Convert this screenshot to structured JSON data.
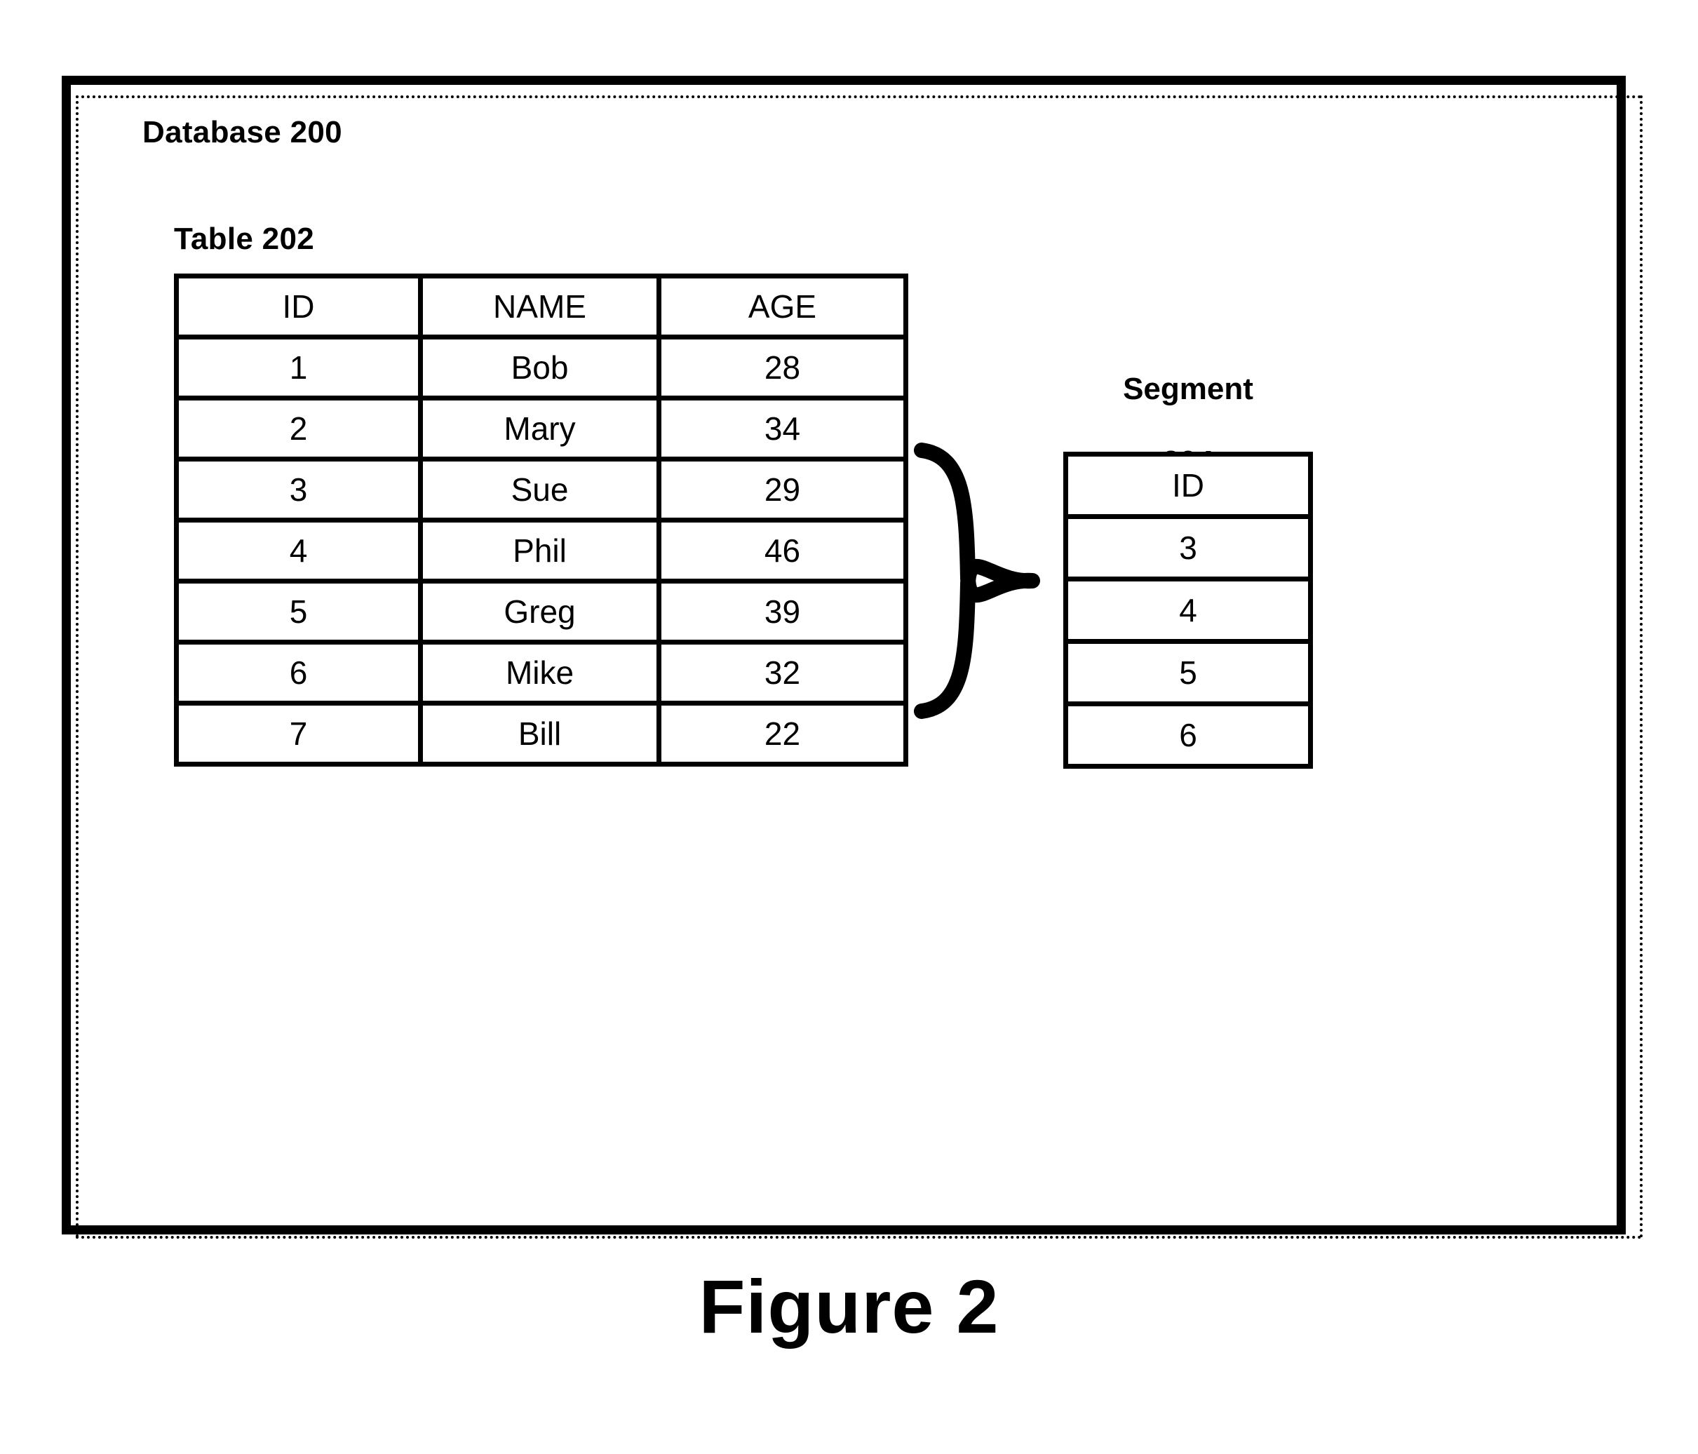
{
  "figure": {
    "caption": "Figure 2"
  },
  "container": {
    "label": "Database 200",
    "border_color": "#000000",
    "background_color": "#ffffff"
  },
  "table": {
    "label": "Table 202",
    "columns": [
      "ID",
      "NAME",
      "AGE"
    ],
    "rows": [
      [
        "1",
        "Bob",
        "28"
      ],
      [
        "2",
        "Mary",
        "34"
      ],
      [
        "3",
        "Sue",
        "29"
      ],
      [
        "4",
        "Phil",
        "46"
      ],
      [
        "5",
        "Greg",
        "39"
      ],
      [
        "6",
        "Mike",
        "32"
      ],
      [
        "7",
        "Bill",
        "22"
      ]
    ]
  },
  "segment": {
    "label": "Segment\n204",
    "label_line1": "Segment",
    "label_line2": "204",
    "columns": [
      "ID"
    ],
    "rows": [
      [
        "3"
      ],
      [
        "4"
      ],
      [
        "5"
      ],
      [
        "6"
      ]
    ]
  },
  "connector": {
    "type": "curly-brace-right",
    "spans_table_rows": [
      "3",
      "4",
      "5",
      "6"
    ]
  }
}
